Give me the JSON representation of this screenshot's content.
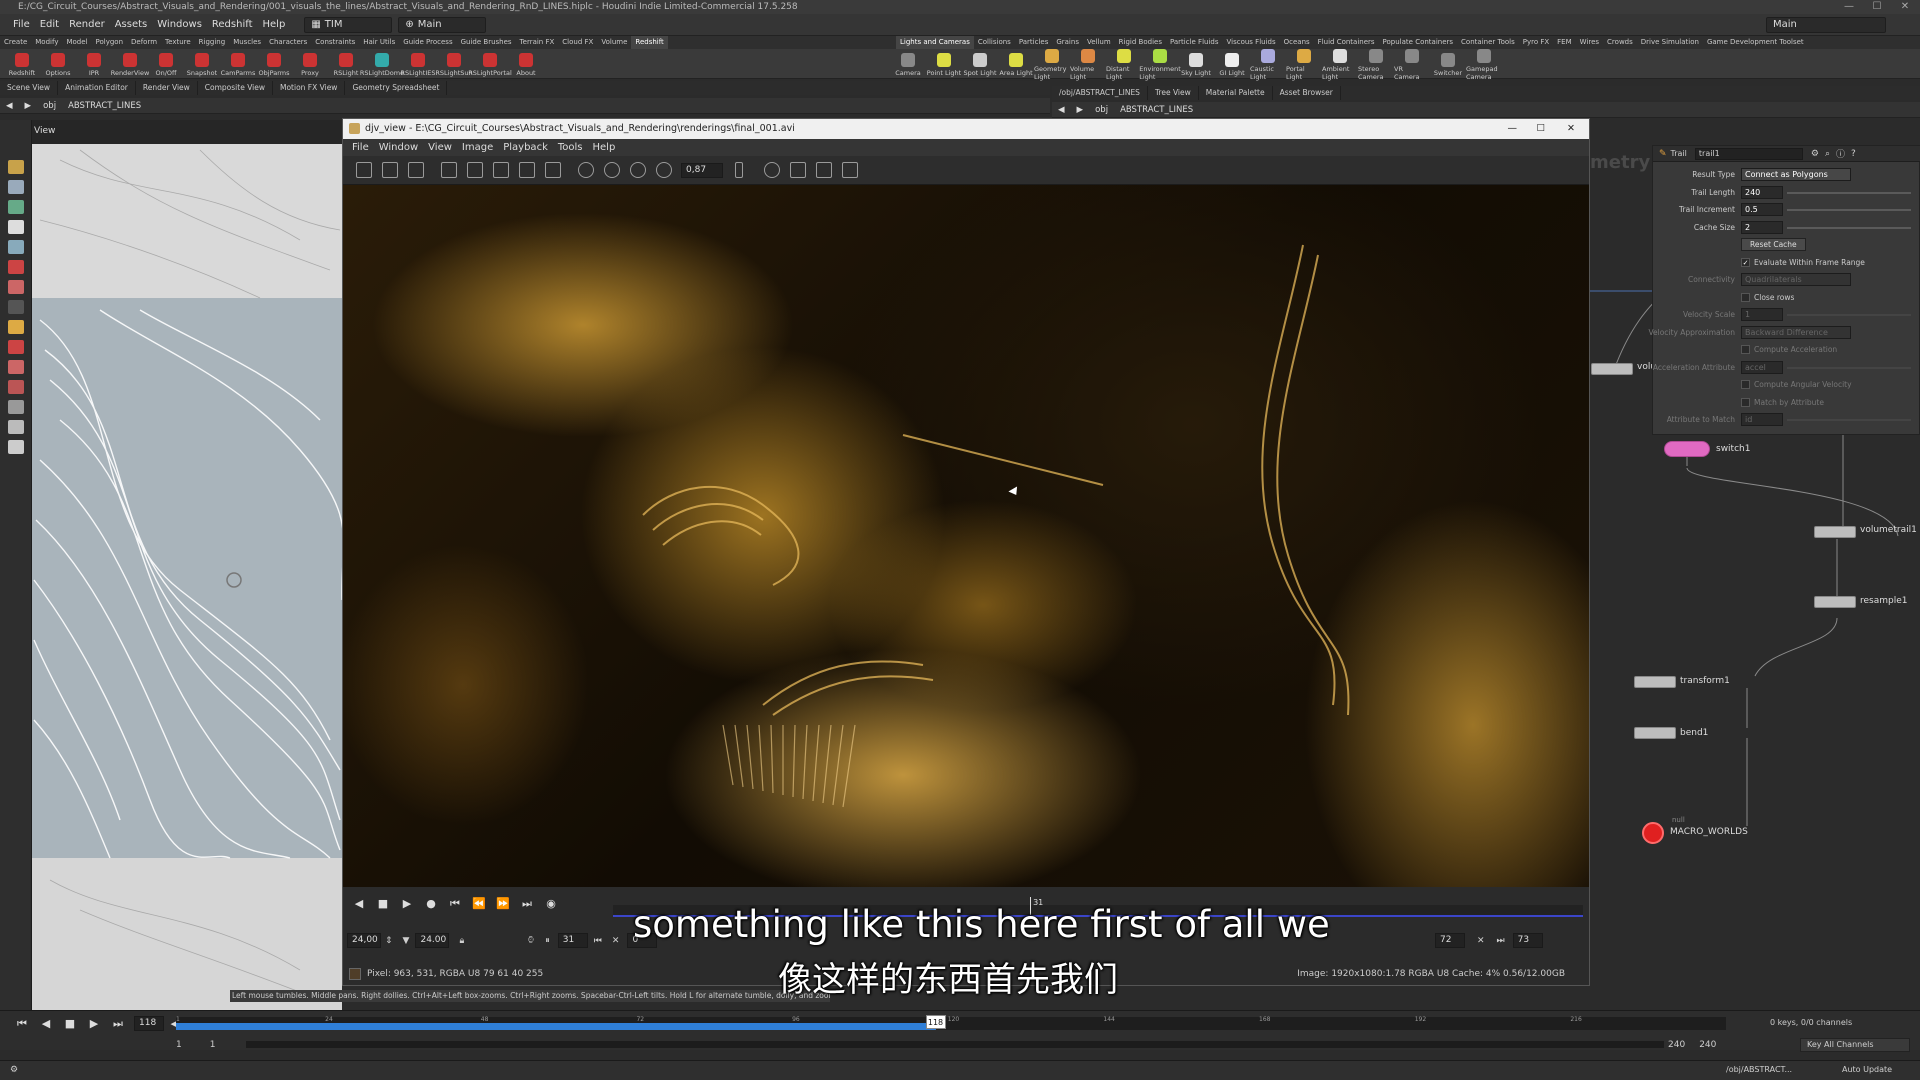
{
  "window": {
    "title": "E:/CG_Circuit_Courses/Abstract_Visuals_and_Rendering/001_visuals_the_lines/Abstract_Visuals_and_Rendering_RnD_LINES.hiplc - Houdini Indie Limited-Commercial 17.5.258",
    "minimize": "—",
    "maximize": "☐",
    "close": "✕"
  },
  "menubar": {
    "items": [
      "File",
      "Edit",
      "Render",
      "Assets",
      "Windows",
      "Redshift",
      "Help"
    ],
    "desktop": "TIM",
    "main": "Main",
    "right_desktop": "Main"
  },
  "shelf_tabs_left": [
    "Create",
    "Modify",
    "Model",
    "Polygon",
    "Deform",
    "Texture",
    "Rigging",
    "Muscles",
    "Characters",
    "Constraints",
    "Hair Utils",
    "Guide Process",
    "Guide Brushes",
    "Terrain FX",
    "Cloud FX",
    "Volume",
    "Redshift"
  ],
  "shelf_tabs_right": [
    "Lights and Cameras",
    "Collisions",
    "Particles",
    "Grains",
    "Vellum",
    "Rigid Bodies",
    "Particle Fluids",
    "Viscous Fluids",
    "Oceans",
    "Fluid Containers",
    "Populate Containers",
    "Container Tools",
    "Pyro FX",
    "FEM",
    "Wires",
    "Crowds",
    "Drive Simulation",
    "Game Development Toolset"
  ],
  "shelf_tools_left": [
    {
      "label": "Redshift",
      "color": "#c33"
    },
    {
      "label": "Options",
      "color": "#c33"
    },
    {
      "label": "IPR",
      "color": "#c33"
    },
    {
      "label": "RenderView",
      "color": "#c33"
    },
    {
      "label": "On/Off",
      "color": "#c33"
    },
    {
      "label": "Snapshot",
      "color": "#c33"
    },
    {
      "label": "CamParms",
      "color": "#c33"
    },
    {
      "label": "ObjParms",
      "color": "#c33"
    },
    {
      "label": "Proxy",
      "color": "#c33"
    },
    {
      "label": "RSLight",
      "color": "#c33"
    },
    {
      "label": "RSLightDome",
      "color": "#3aa"
    },
    {
      "label": "RSLightIES",
      "color": "#c33"
    },
    {
      "label": "RSLightSun",
      "color": "#c33"
    },
    {
      "label": "RSLightPortal",
      "color": "#c33"
    },
    {
      "label": "About",
      "color": "#c33"
    }
  ],
  "shelf_tools_right": [
    {
      "label": "Camera",
      "color": "#888"
    },
    {
      "label": "Point Light",
      "color": "#dd4"
    },
    {
      "label": "Spot Light",
      "color": "#ccc"
    },
    {
      "label": "Area Light",
      "color": "#dd4"
    },
    {
      "label": "Geometry Light",
      "color": "#da4"
    },
    {
      "label": "Volume Light",
      "color": "#d84"
    },
    {
      "label": "Distant Light",
      "color": "#dd4"
    },
    {
      "label": "Environment Light",
      "color": "#ad4"
    },
    {
      "label": "Sky Light",
      "color": "#ddd"
    },
    {
      "label": "GI Light",
      "color": "#eee"
    },
    {
      "label": "Caustic Light",
      "color": "#aad"
    },
    {
      "label": "Portal Light",
      "color": "#da4"
    },
    {
      "label": "Ambient Light",
      "color": "#ddd"
    },
    {
      "label": "Stereo Camera",
      "color": "#888"
    },
    {
      "label": "VR Camera",
      "color": "#888"
    },
    {
      "label": "Switcher",
      "color": "#888"
    },
    {
      "label": "Gamepad Camera",
      "color": "#888"
    }
  ],
  "left_pane_tabs": [
    "Scene View",
    "Animation Editor",
    "Render View",
    "Composite View",
    "Motion FX View",
    "Geometry Spreadsheet"
  ],
  "left_path": {
    "root": "obj",
    "node": "ABSTRACT_LINES"
  },
  "viewport_label": "View",
  "right_pane_tabs": [
    "/obj/ABSTRACT_LINES",
    "Tree View",
    "Material Palette",
    "Asset Browser"
  ],
  "right_path": {
    "root": "obj",
    "node": "ABSTRACT_LINES"
  },
  "mplay": {
    "title": "djv_view - E:\\CG_Circuit_Courses\\Abstract_Visuals_and_Rendering\\renderings\\final_001.avi",
    "menu": [
      "File",
      "Window",
      "View",
      "Image",
      "Playback",
      "Tools",
      "Help"
    ],
    "zoom": "0,87",
    "fps": "24,00",
    "fps_target": "24.00",
    "frame": "31",
    "frame_marker": "31",
    "in_frame": "0",
    "out_frame": "72",
    "end_frame": "73",
    "pixel_info": "Pixel: 963, 531, RGBA U8 79 61 40 255",
    "image_info": "Image: 1920x1080:1.78 RGBA U8  Cache: 4% 0.56/12.00GB",
    "playhead_progress": 0.43
  },
  "subtitles": {
    "en": "something like this here first of all we",
    "zh": "像这样的东西首先我们"
  },
  "viewport_hint": "Left mouse tumbles. Middle pans. Right dollies. Ctrl+Alt+Left box-zooms. Ctrl+Right zooms. Spacebar-Ctrl-Left tilts. Hold L for alternate tumble, dolly, and zoom.",
  "network_header": "metry",
  "params": {
    "node_type": "Trail",
    "node_name": "trail1",
    "rows": [
      {
        "label": "Result Type",
        "kind": "menu",
        "value": "Connect as Polygons"
      },
      {
        "label": "Trail Length",
        "kind": "field",
        "value": "240"
      },
      {
        "label": "Trail Increment",
        "kind": "field",
        "value": "0.5"
      },
      {
        "label": "Cache Size",
        "kind": "field",
        "value": "2"
      },
      {
        "label": "",
        "kind": "button",
        "value": "Reset Cache"
      },
      {
        "label": "",
        "kind": "check",
        "value": "Evaluate Within Frame Range",
        "checked": true
      },
      {
        "label": "Connectivity",
        "kind": "menu",
        "value": "Quadrilaterals",
        "dim": true
      },
      {
        "label": "",
        "kind": "check",
        "value": "Close rows",
        "checked": false
      },
      {
        "label": "Velocity Scale",
        "kind": "field",
        "value": "1",
        "dim": true
      },
      {
        "label": "Velocity Approximation",
        "kind": "menu",
        "value": "Backward Difference",
        "dim": true
      },
      {
        "label": "",
        "kind": "check",
        "value": "Compute Acceleration",
        "checked": false,
        "dim": true
      },
      {
        "label": "Acceleration Attribute",
        "kind": "field",
        "value": "accel",
        "dim": true
      },
      {
        "label": "",
        "kind": "check",
        "value": "Compute Angular Velocity",
        "checked": false,
        "dim": true
      },
      {
        "label": "",
        "kind": "check",
        "value": "Match by Attribute",
        "checked": false,
        "dim": true
      },
      {
        "label": "Attribute to Match",
        "kind": "field",
        "value": "id",
        "dim": true
      }
    ]
  },
  "nodes": {
    "vol": "volu",
    "switch": "switch1",
    "volumetrail": "volumetrail1",
    "resample": "resample1",
    "transform": "transform1",
    "bend": "bend1",
    "output": "MACRO_WORLDS",
    "output_tag": "null"
  },
  "timeline": {
    "current_frame": "118",
    "ticks": [
      "1",
      "24",
      "48",
      "72",
      "96",
      "120",
      "144",
      "168",
      "192",
      "216"
    ],
    "range_start": "1",
    "range_start2": "1",
    "range_end": "240",
    "range_end2": "240",
    "playhead_fraction": 0.49,
    "keys_info": "0 keys, 0/0 channels",
    "key_all": "Key All Channels"
  },
  "statusbar": {
    "path": "/obj/ABSTRACT...",
    "update": "Auto Update"
  }
}
